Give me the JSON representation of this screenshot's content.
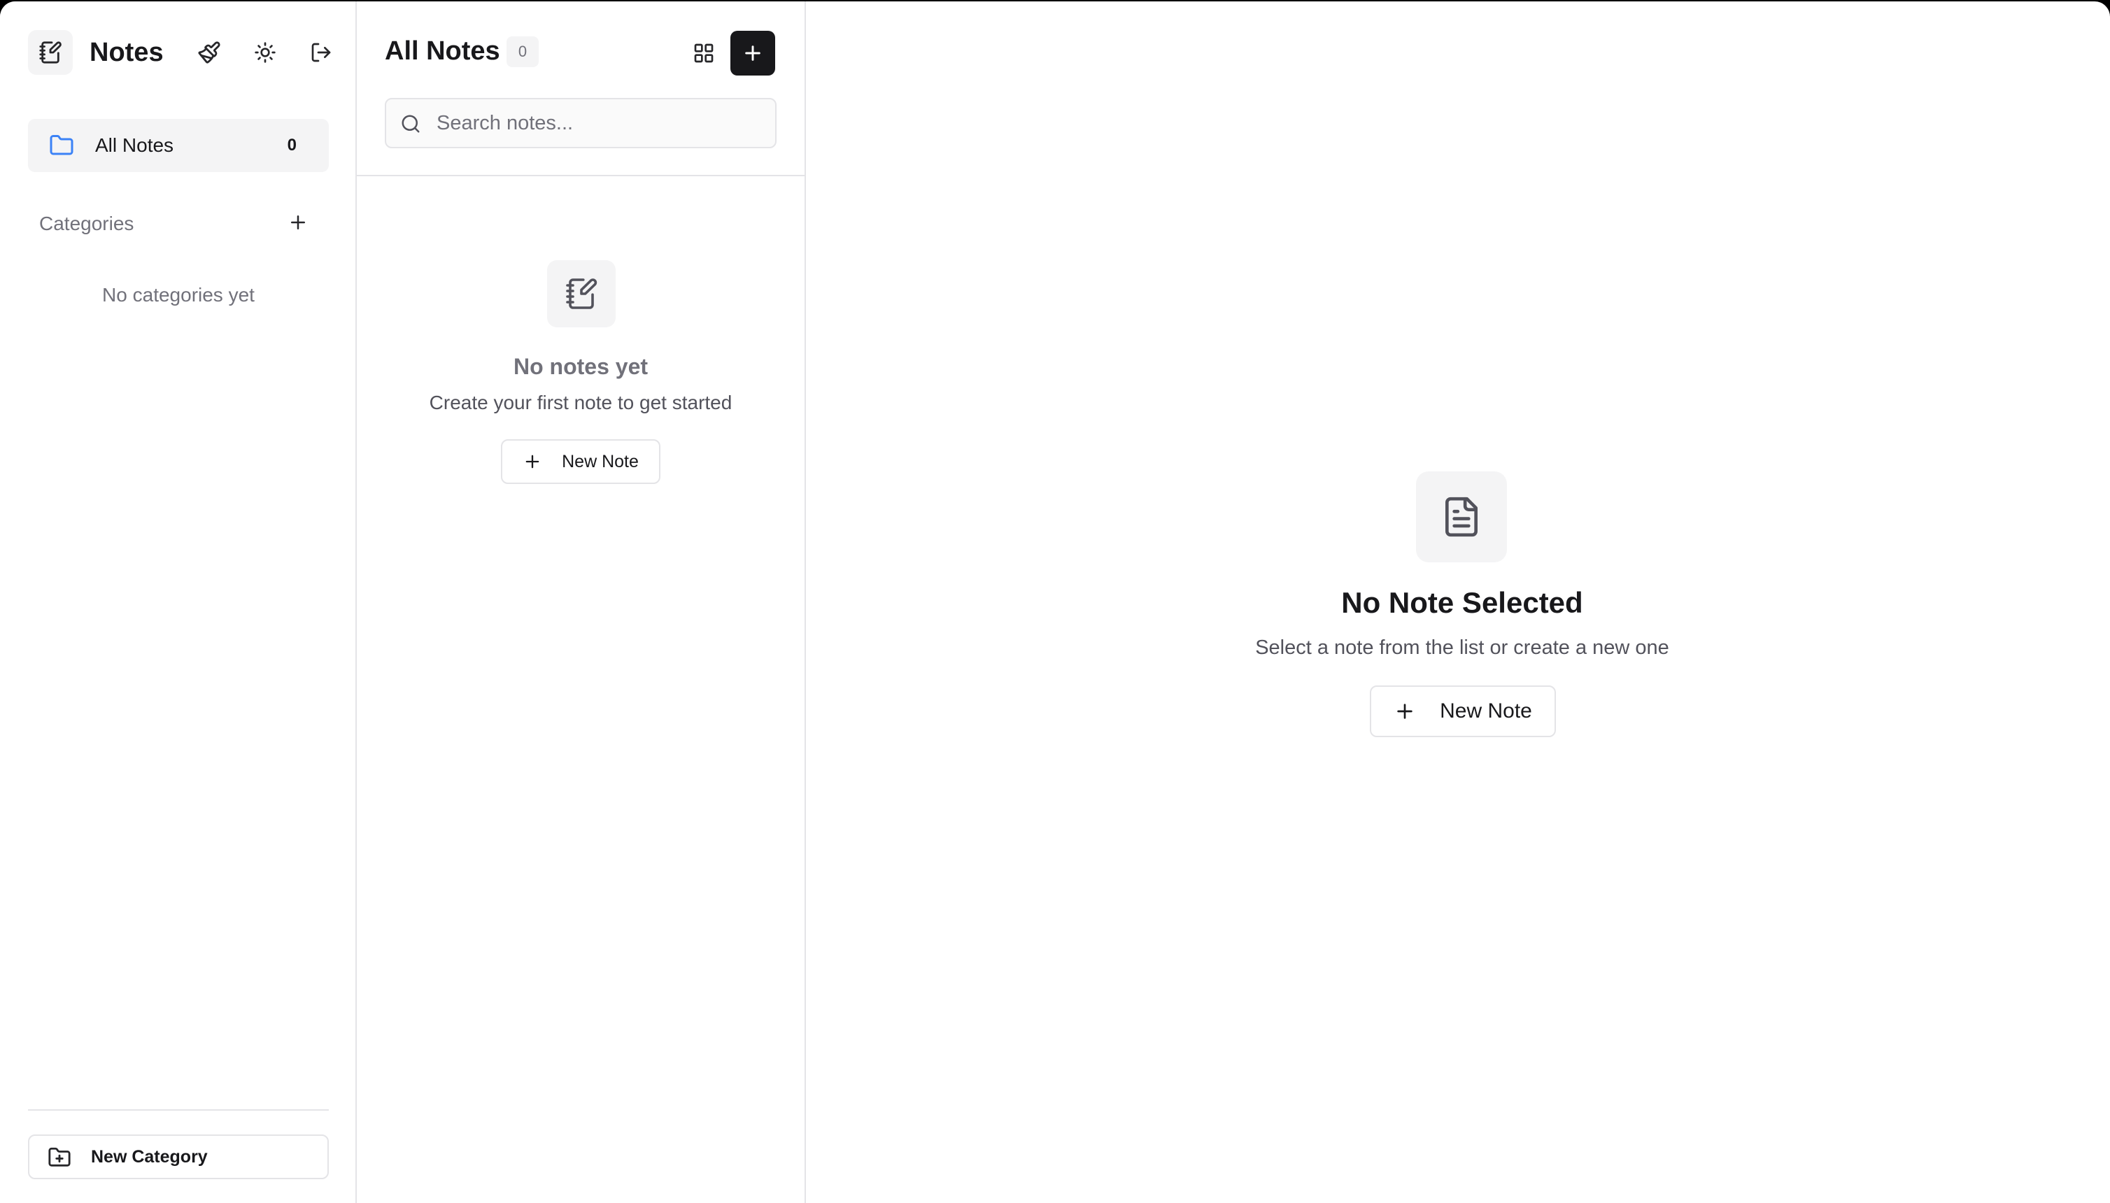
{
  "sidebar": {
    "app_title": "Notes",
    "header_icons": [
      "logo-notebook-icon",
      "brush-icon",
      "sun-icon",
      "logout-icon"
    ],
    "all_notes": {
      "label": "All Notes",
      "count": "0"
    },
    "categories": {
      "title": "Categories",
      "empty_text": "No categories yet"
    },
    "new_category_label": "New Category"
  },
  "notes_list": {
    "title": "All Notes",
    "count": "0",
    "search": {
      "placeholder": "Search notes..."
    },
    "empty": {
      "title": "No notes yet",
      "subtitle": "Create your first note to get started",
      "button_label": "New Note"
    }
  },
  "main": {
    "empty": {
      "title": "No Note Selected",
      "subtitle": "Select a note from the list or create a new one",
      "button_label": "New Note"
    }
  },
  "colors": {
    "accent_dark": "#18181b",
    "muted_bg": "#f4f4f5",
    "border": "#e4e4e7",
    "folder_blue": "#3b82f6"
  }
}
